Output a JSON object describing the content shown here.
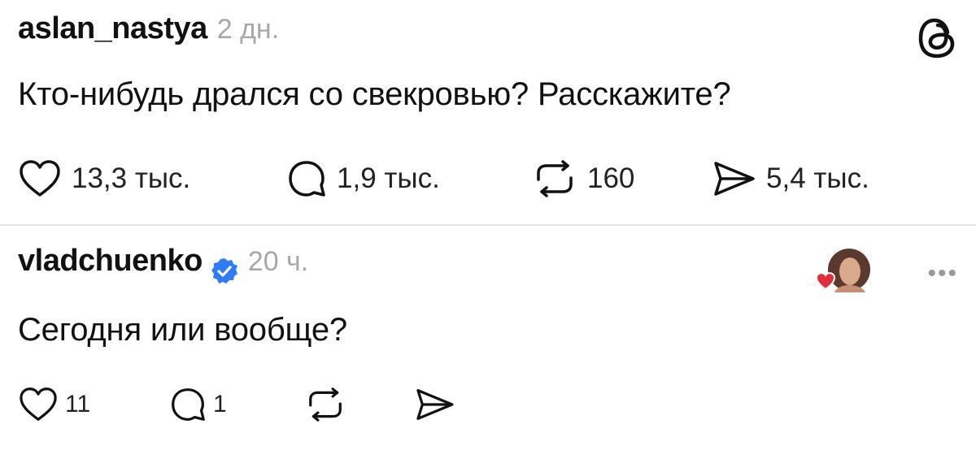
{
  "posts": [
    {
      "username": "aslan_nastya",
      "time": "2 дн.",
      "verified": false,
      "text": "Кто-нибудь дрался со свекровью? Расскажите?",
      "actions": {
        "likes": "13,3 тыс.",
        "replies": "1,9 тыс.",
        "reposts": "160",
        "shares": "5,4 тыс."
      }
    },
    {
      "username": "vladchuenko",
      "time": "20 ч.",
      "verified": true,
      "text": "Сегодня или вообще?",
      "actions": {
        "likes": "11",
        "replies": "1",
        "reposts": "",
        "shares": ""
      }
    }
  ],
  "icons": {
    "logo": "threads-logo-icon",
    "like": "heart-icon",
    "reply": "speech-bubble-icon",
    "repost": "repost-icon",
    "share": "send-icon",
    "verified": "verified-badge-icon",
    "more": "more-icon",
    "reaction": "liked-by-author-icon"
  },
  "colors": {
    "text": "#111111",
    "muted": "#a8a8a8",
    "verified": "#2e7cf6",
    "heart": "#e02f3b"
  }
}
